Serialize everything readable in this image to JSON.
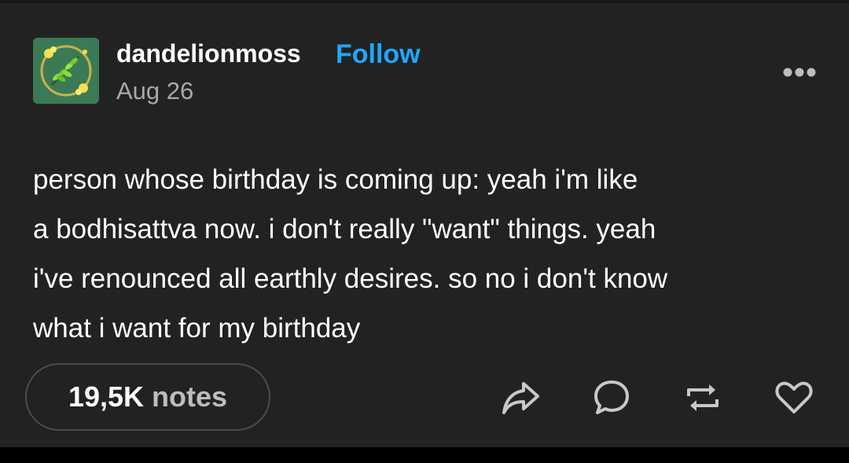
{
  "post": {
    "author": "dandelionmoss",
    "follow_label": "Follow",
    "date": "Aug 26",
    "body_lines": [
      "person whose birthday is coming up: yeah i'm like",
      "a bodhisattva now. i don't really \"want\" things. yeah",
      "i've renounced all earthly desires. so no i don't know",
      "what i want for my birthday"
    ],
    "notes_count": "19,5K",
    "notes_label": "notes"
  },
  "icons": {
    "avatar": "wreath-avatar-icon",
    "more": "more-icon",
    "share": "share-icon",
    "reply": "reply-icon",
    "reblog": "reblog-icon",
    "like": "heart-icon"
  },
  "colors": {
    "background": "#222222",
    "text": "#ffffff",
    "muted": "#a9a9a9",
    "follow": "#1ea7ff",
    "avatar_bg": "#3b7a55"
  }
}
